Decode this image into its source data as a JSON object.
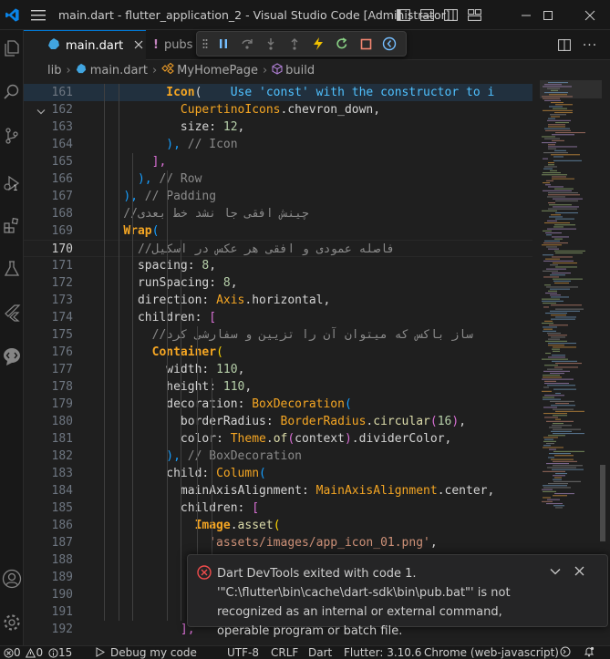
{
  "titlebar": {
    "title": "main.dart - flutter_application_2 - Visual Studio Code [Administrator]"
  },
  "activity": {
    "items": [
      {
        "name": "explorer"
      },
      {
        "name": "search"
      },
      {
        "name": "source-control"
      },
      {
        "name": "run-and-debug",
        "badge": "1"
      },
      {
        "name": "extensions"
      },
      {
        "name": "testing"
      },
      {
        "name": "flutter"
      },
      {
        "name": "remote"
      },
      {
        "name": "accounts"
      },
      {
        "name": "manage"
      }
    ]
  },
  "tabs": [
    {
      "label": "main.dart",
      "active": true
    },
    {
      "label": "pubs",
      "active": false
    }
  ],
  "breadcrumb": {
    "folder": "lib",
    "file": "main.dart",
    "class": "MyHomePage",
    "method": "build"
  },
  "editor": {
    "current_line": 170,
    "lines": [
      {
        "n": 161,
        "indent": 0,
        "tokens": [
          [
            "cls",
            "          Icon"
          ],
          [
            "pun",
            "("
          ],
          [
            "hint",
            "    Use 'const' with the constructor to i"
          ]
        ]
      },
      {
        "n": 162,
        "indent": 0,
        "tokens": [
          [
            "pl",
            "            "
          ],
          [
            "cls",
            "CupertinoIcons"
          ],
          [
            "pun",
            "."
          ],
          [
            "prop",
            "chevron_down"
          ],
          [
            "pun",
            ","
          ]
        ]
      },
      {
        "n": 163,
        "indent": 0,
        "tokens": [
          [
            "pl",
            "            "
          ],
          [
            "prop",
            "size"
          ],
          [
            "pun",
            ": "
          ],
          [
            "num",
            "12"
          ],
          [
            "pun",
            ","
          ]
        ]
      },
      {
        "n": 164,
        "indent": 0,
        "tokens": [
          [
            "pl",
            "          "
          ],
          [
            "br",
            "),"
          ],
          [
            "cm",
            " // Icon"
          ]
        ]
      },
      {
        "n": 165,
        "indent": 0,
        "tokens": [
          [
            "pl",
            "        "
          ],
          [
            "br2",
            "],"
          ]
        ]
      },
      {
        "n": 166,
        "indent": 0,
        "tokens": [
          [
            "pl",
            "      "
          ],
          [
            "br",
            "),"
          ],
          [
            "cm",
            " // Row"
          ]
        ]
      },
      {
        "n": 167,
        "indent": 0,
        "tokens": [
          [
            "pl",
            "    "
          ],
          [
            "br",
            "),"
          ],
          [
            "cm",
            " // Padding"
          ]
        ]
      },
      {
        "n": 168,
        "indent": 0,
        "tokens": [
          [
            "cm",
            "    //چینش افقی جا نشد خط بعدی"
          ]
        ]
      },
      {
        "n": 169,
        "indent": 0,
        "tokens": [
          [
            "pl",
            "    "
          ],
          [
            "cls",
            "Wrap"
          ],
          [
            "br",
            "("
          ]
        ]
      },
      {
        "n": 170,
        "indent": 0,
        "tokens": [
          [
            "cm",
            "      //فاصله عمودی و افقی هر عکس در اسکیل"
          ]
        ]
      },
      {
        "n": 171,
        "indent": 0,
        "tokens": [
          [
            "pl",
            "      "
          ],
          [
            "prop",
            "spacing"
          ],
          [
            "pun",
            ": "
          ],
          [
            "num",
            "8"
          ],
          [
            "pun",
            ","
          ]
        ]
      },
      {
        "n": 172,
        "indent": 0,
        "tokens": [
          [
            "pl",
            "      "
          ],
          [
            "prop",
            "runSpacing"
          ],
          [
            "pun",
            ": "
          ],
          [
            "num",
            "8"
          ],
          [
            "pun",
            ","
          ]
        ]
      },
      {
        "n": 173,
        "indent": 0,
        "tokens": [
          [
            "pl",
            "      "
          ],
          [
            "prop",
            "direction"
          ],
          [
            "pun",
            ": "
          ],
          [
            "cls",
            "Axis"
          ],
          [
            "pun",
            "."
          ],
          [
            "prop",
            "horizontal"
          ],
          [
            "pun",
            ","
          ]
        ]
      },
      {
        "n": 174,
        "indent": 0,
        "tokens": [
          [
            "pl",
            "      "
          ],
          [
            "prop",
            "children"
          ],
          [
            "pun",
            ": "
          ],
          [
            "br2",
            "["
          ]
        ]
      },
      {
        "n": 175,
        "indent": 0,
        "tokens": [
          [
            "cm",
            "        //ساز باکس که میتوان آن را تزیین و سفارشی کرد"
          ]
        ]
      },
      {
        "n": 176,
        "indent": 0,
        "tokens": [
          [
            "pl",
            "        "
          ],
          [
            "cls",
            "Container"
          ],
          [
            "br3",
            "("
          ]
        ]
      },
      {
        "n": 177,
        "indent": 0,
        "tokens": [
          [
            "pl",
            "          "
          ],
          [
            "prop",
            "width"
          ],
          [
            "pun",
            ": "
          ],
          [
            "num",
            "110"
          ],
          [
            "pun",
            ","
          ]
        ]
      },
      {
        "n": 178,
        "indent": 0,
        "tokens": [
          [
            "pl",
            "          "
          ],
          [
            "prop",
            "height"
          ],
          [
            "pun",
            ": "
          ],
          [
            "num",
            "110"
          ],
          [
            "pun",
            ","
          ]
        ]
      },
      {
        "n": 179,
        "indent": 0,
        "tokens": [
          [
            "pl",
            "          "
          ],
          [
            "prop",
            "decoration"
          ],
          [
            "pun",
            ": "
          ],
          [
            "cls",
            "BoxDecoration"
          ],
          [
            "br",
            "("
          ]
        ]
      },
      {
        "n": 180,
        "indent": 0,
        "tokens": [
          [
            "pl",
            "            "
          ],
          [
            "prop",
            "borderRadius"
          ],
          [
            "pun",
            ": "
          ],
          [
            "cls",
            "BorderRadius"
          ],
          [
            "pun",
            "."
          ],
          [
            "fn",
            "circular"
          ],
          [
            "br2",
            "("
          ],
          [
            "num",
            "16"
          ],
          [
            "br2",
            ")"
          ],
          [
            "pun",
            ","
          ]
        ]
      },
      {
        "n": 181,
        "indent": 0,
        "tokens": [
          [
            "pl",
            "            "
          ],
          [
            "prop",
            "color"
          ],
          [
            "pun",
            ": "
          ],
          [
            "cls",
            "Theme"
          ],
          [
            "pun",
            "."
          ],
          [
            "fn",
            "of"
          ],
          [
            "br2",
            "("
          ],
          [
            "pl",
            "context"
          ],
          [
            "br2",
            ")"
          ],
          [
            "pun",
            "."
          ],
          [
            "prop",
            "dividerColor"
          ],
          [
            "pun",
            ","
          ]
        ]
      },
      {
        "n": 182,
        "indent": 0,
        "tokens": [
          [
            "pl",
            "          "
          ],
          [
            "br",
            "),"
          ],
          [
            "cm",
            " // BoxDecoration"
          ]
        ]
      },
      {
        "n": 183,
        "indent": 0,
        "tokens": [
          [
            "pl",
            "          "
          ],
          [
            "prop",
            "child"
          ],
          [
            "pun",
            ": "
          ],
          [
            "cls",
            "Column"
          ],
          [
            "br",
            "("
          ]
        ]
      },
      {
        "n": 184,
        "indent": 0,
        "tokens": [
          [
            "pl",
            "            "
          ],
          [
            "prop",
            "mainAxisAlignment"
          ],
          [
            "pun",
            ": "
          ],
          [
            "cls",
            "MainAxisAlignment"
          ],
          [
            "pun",
            "."
          ],
          [
            "prop",
            "center"
          ],
          [
            "pun",
            ","
          ]
        ]
      },
      {
        "n": 185,
        "indent": 0,
        "tokens": [
          [
            "pl",
            "            "
          ],
          [
            "prop",
            "children"
          ],
          [
            "pun",
            ": "
          ],
          [
            "br2",
            "["
          ]
        ]
      },
      {
        "n": 186,
        "indent": 0,
        "tokens": [
          [
            "pl",
            "              "
          ],
          [
            "cls",
            "Image"
          ],
          [
            "pun",
            "."
          ],
          [
            "fn",
            "asset"
          ],
          [
            "br3",
            "("
          ]
        ]
      },
      {
        "n": 187,
        "indent": 0,
        "tokens": [
          [
            "pl",
            "                "
          ],
          [
            "str",
            "'assets/images/app_icon_01.png'"
          ],
          [
            "pun",
            ","
          ]
        ]
      },
      {
        "n": 188,
        "indent": 0,
        "tokens": []
      },
      {
        "n": 189,
        "indent": 0,
        "tokens": []
      },
      {
        "n": 190,
        "indent": 0,
        "tokens": []
      },
      {
        "n": 191,
        "indent": 0,
        "tokens": []
      },
      {
        "n": 192,
        "indent": 0,
        "tokens": [
          [
            "pl",
            "            "
          ],
          [
            "br2",
            "],"
          ]
        ]
      }
    ]
  },
  "notification": {
    "message": "Dart DevTools exited with code 1. '\"C:\\flutter\\bin\\cache\\dart-sdk\\bin\\pub.bat\"' is not recognized as an internal or external command, operable program or batch file."
  },
  "statusbar": {
    "errors": "0",
    "warnings": "0",
    "infos": "15",
    "debug": "Debug my code",
    "encoding": "UTF-8",
    "eol": "CRLF",
    "language": "Dart",
    "flutter": "Flutter: 3.10.6",
    "device": "Chrome (web-javascript)"
  },
  "colors": {
    "accent": "#0078d4",
    "error": "#f14c4c",
    "class": "#f5a623",
    "property": "#d4d4d4",
    "number": "#b5cea8",
    "comment": "#8a8a8a",
    "string": "#ce9178",
    "hint": "#4fc1ff"
  }
}
